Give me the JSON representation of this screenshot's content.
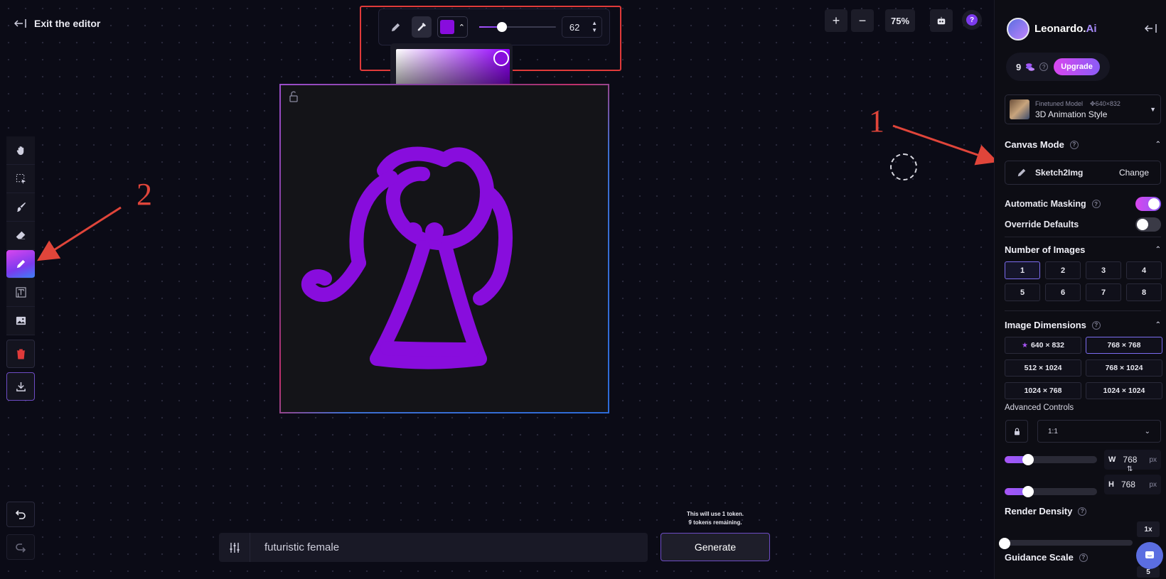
{
  "editor": {
    "exit_label": "Exit the editor"
  },
  "toolbar": {
    "brush_color": "#880DDD",
    "brush_size": "62",
    "brush_size_fraction": 0.3,
    "picker_hex": "#880DDD"
  },
  "zoom": {
    "plus": "+",
    "minus": "−",
    "level": "75%"
  },
  "annotations": {
    "label_1": "1",
    "label_2": "2",
    "color": "#e0453a"
  },
  "prompt": {
    "value": "futuristic female",
    "token_line1": "This will use 1 token.",
    "token_line2": "9 tokens remaining.",
    "generate_label": "Generate"
  },
  "panel": {
    "brand": "Leonardo.",
    "brand_suffix": "Ai",
    "credits": "9",
    "upgrade_label": "Upgrade",
    "model_type": "Finetuned Model",
    "model_dims": "640×832",
    "model_name": "3D Animation Style",
    "canvas_mode_title": "Canvas Mode",
    "canvas_mode_value": "Sketch2Img",
    "canvas_mode_change": "Change",
    "auto_masking_label": "Automatic Masking",
    "auto_masking_on": true,
    "override_defaults_label": "Override Defaults",
    "override_defaults_on": false,
    "num_images_title": "Number of Images",
    "num_images": [
      "1",
      "2",
      "3",
      "4",
      "5",
      "6",
      "7",
      "8"
    ],
    "num_images_selected": "1",
    "dims_title": "Image Dimensions",
    "dims": [
      "640 × 832",
      "768 × 768",
      "512 × 1024",
      "768 × 1024",
      "1024 × 768",
      "1024 × 1024"
    ],
    "dims_selected": "768 × 768",
    "advanced_label": "Advanced Controls",
    "ratio": "1:1",
    "width_label": "W",
    "width_value": "768",
    "height_label": "H",
    "height_value": "768",
    "unit": "px",
    "width_fraction": 0.25,
    "height_fraction": 0.25,
    "render_density_title": "Render Density",
    "render_density_value": "1x",
    "render_density_fraction": 0.0,
    "guidance_title": "Guidance Scale",
    "guidance_value": "5",
    "guidance_fraction": 0.3
  },
  "accent": "#8b5cf6"
}
